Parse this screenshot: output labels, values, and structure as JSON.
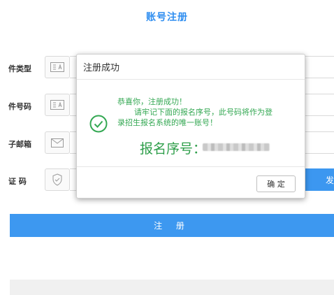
{
  "page": {
    "title": "账号注册"
  },
  "form": {
    "rows": [
      {
        "label": "件类型",
        "icon": "id-card-icon"
      },
      {
        "label": "件号码",
        "icon": "id-card-icon"
      },
      {
        "label": "子邮箱",
        "icon": "mail-icon"
      },
      {
        "label": "证  码",
        "icon": "shield-check-icon"
      }
    ],
    "send_label": "发",
    "register_label": "注 册"
  },
  "dialog": {
    "title": "注册成功",
    "line1": "恭喜你，注册成功！",
    "line2": "请牢记下面的报名序号，此号码将作为登",
    "line3": "录招生报名系统的唯一账号！",
    "serial_label": "报名序号：",
    "ok_label": "确 定",
    "success_color": "#34a853"
  },
  "colors": {
    "accent": "#3d98f0",
    "title": "#2f8ef0"
  }
}
